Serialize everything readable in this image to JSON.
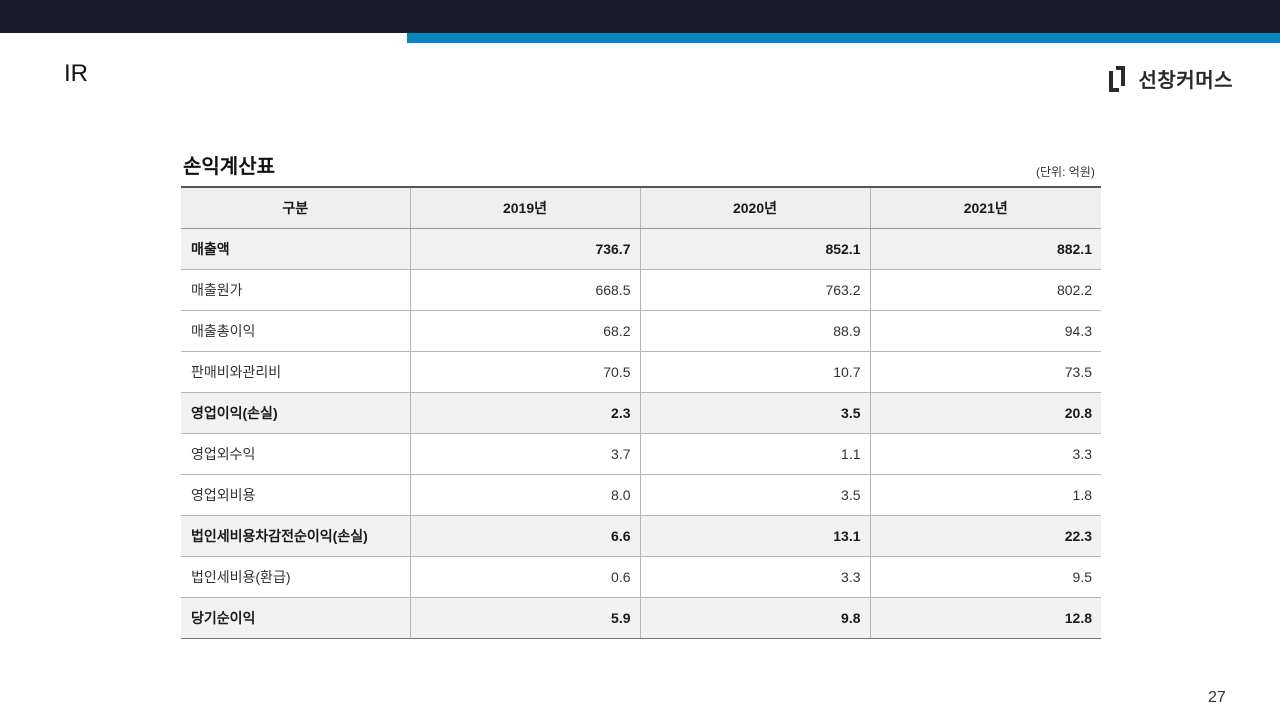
{
  "header": {
    "section": "IR",
    "brand": "선창커머스"
  },
  "colors": {
    "top_bar": "#181c2c",
    "accent": "#0b86be",
    "bold_row_bg": "#f2f2f2",
    "header_bg": "#efefef"
  },
  "statement": {
    "title": "손익계산표",
    "unit": "(단위: 억원)",
    "columns": [
      "구분",
      "2019년",
      "2020년",
      "2021년"
    ],
    "rows": [
      {
        "label": "매출액",
        "values": [
          "736.7",
          "852.1",
          "882.1"
        ]
      },
      {
        "label": "매출원가",
        "values": [
          "668.5",
          "763.2",
          "802.2"
        ]
      },
      {
        "label": "매출총이익",
        "values": [
          "68.2",
          "88.9",
          "94.3"
        ]
      },
      {
        "label": "판매비와관리비",
        "values": [
          "70.5",
          "10.7",
          "73.5"
        ]
      },
      {
        "label": "영업이익(손실)",
        "values": [
          "2.3",
          "3.5",
          "20.8"
        ]
      },
      {
        "label": "영업외수익",
        "values": [
          "3.7",
          "1.1",
          "3.3"
        ]
      },
      {
        "label": "영업외비용",
        "values": [
          "8.0",
          "3.5",
          "1.8"
        ]
      },
      {
        "label": "법인세비용차감전순이익(손실)",
        "values": [
          "6.6",
          "13.1",
          "22.3"
        ]
      },
      {
        "label": "법인세비용(환급)",
        "values": [
          "0.6",
          "3.3",
          "9.5"
        ]
      },
      {
        "label": "당기순이익",
        "values": [
          "5.9",
          "9.8",
          "12.8"
        ]
      }
    ]
  },
  "footer": {
    "page_number": "27"
  }
}
